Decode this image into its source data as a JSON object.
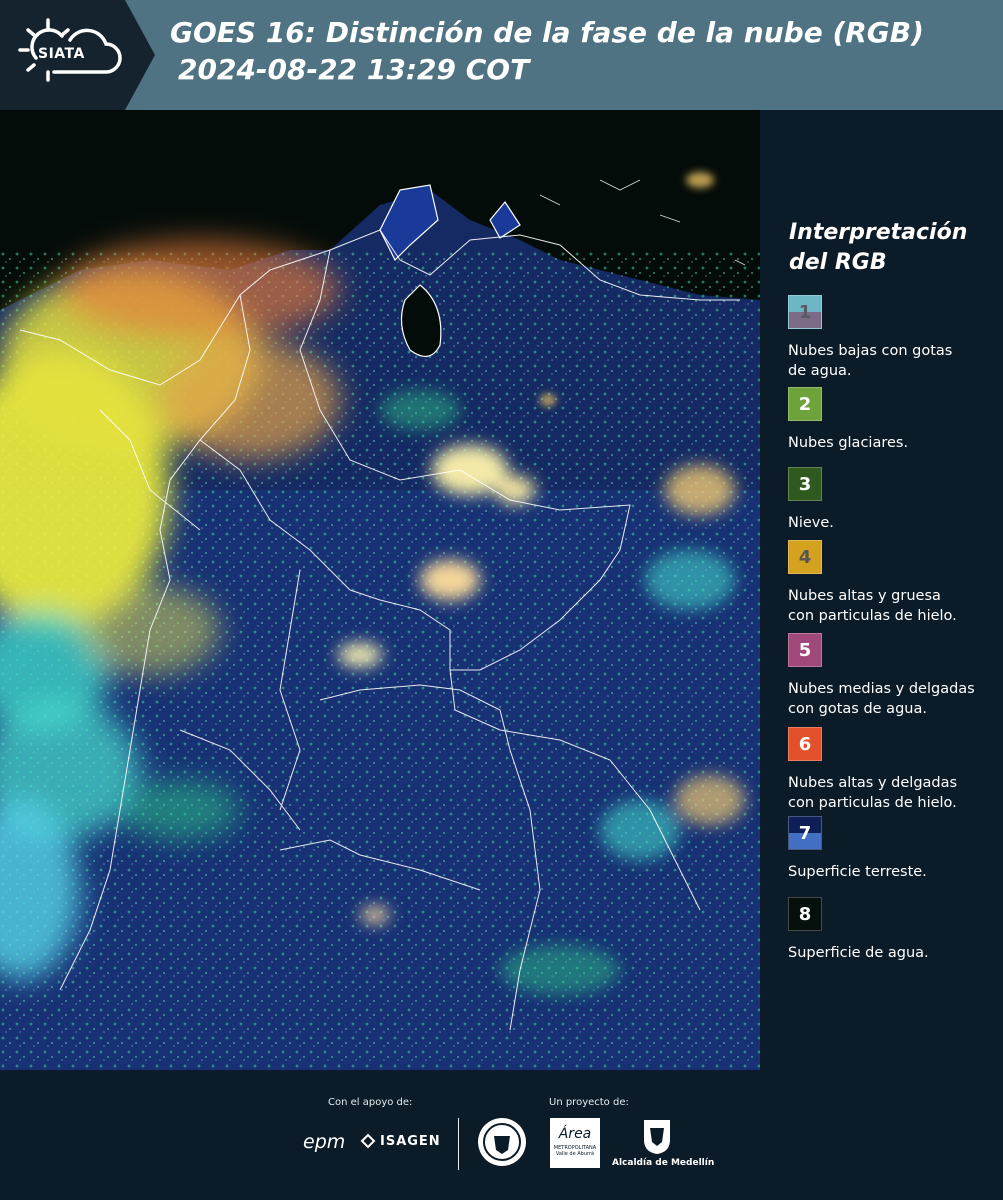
{
  "header": {
    "logo_text": "SIATA",
    "title_line1": "GOES 16: Distinción de la fase de la nube (RGB)",
    "title_line2": "2024-08-22 13:29 COT"
  },
  "legend": {
    "title_line1": "Interpretación",
    "title_line2": "del RGB",
    "items": [
      {
        "num": "1",
        "top": "#6db7c5",
        "bottom": "#7b6b87",
        "numcolor": "#5a5a66",
        "label_lines": [
          "Nubes bajas con gotas",
          "de agua."
        ]
      },
      {
        "num": "2",
        "top": "#6ea23a",
        "bottom": "#6ea23a",
        "numcolor": "#ffffff",
        "label_lines": [
          "Nubes glaciares."
        ]
      },
      {
        "num": "3",
        "top": "#2f5a1f",
        "bottom": "#2f5a1f",
        "numcolor": "#ffffff",
        "label_lines": [
          "Nieve."
        ]
      },
      {
        "num": "4",
        "top": "#d4a21f",
        "bottom": "#d4a21f",
        "numcolor": "#555555",
        "label_lines": [
          "Nubes altas y gruesa",
          "con particulas de hielo."
        ]
      },
      {
        "num": "5",
        "top": "#a04879",
        "bottom": "#a04879",
        "numcolor": "#ffffff",
        "label_lines": [
          "Nubes medias y delgadas",
          "con gotas de agua."
        ]
      },
      {
        "num": "6",
        "top": "#e2512b",
        "bottom": "#e2512b",
        "numcolor": "#ffffff",
        "label_lines": [
          "Nubes altas y delgadas",
          "con particulas de hielo."
        ]
      },
      {
        "num": "7",
        "top": "#0e1f57",
        "bottom": "#4470c4",
        "numcolor": "#ffffff",
        "label_lines": [
          "Superficie terreste."
        ]
      },
      {
        "num": "8",
        "top": "#05100c",
        "bottom": "#05100c",
        "numcolor": "#ffffff",
        "label_lines": [
          "Superficie de agua."
        ]
      }
    ]
  },
  "footer": {
    "support_label": "Con el apoyo de:",
    "project_label": "Un proyecto de:",
    "epm": "epm",
    "isagen": "ISAGEN",
    "area_top": "Área",
    "area_line1": "METROPOLITANA",
    "area_line2": "Valle de Aburrá",
    "alcaldia": "Alcaldía de Medellín"
  },
  "colors": {
    "header_bg": "#4f7382",
    "logo_bg": "#15232e",
    "panel_bg": "#0b1b27"
  }
}
